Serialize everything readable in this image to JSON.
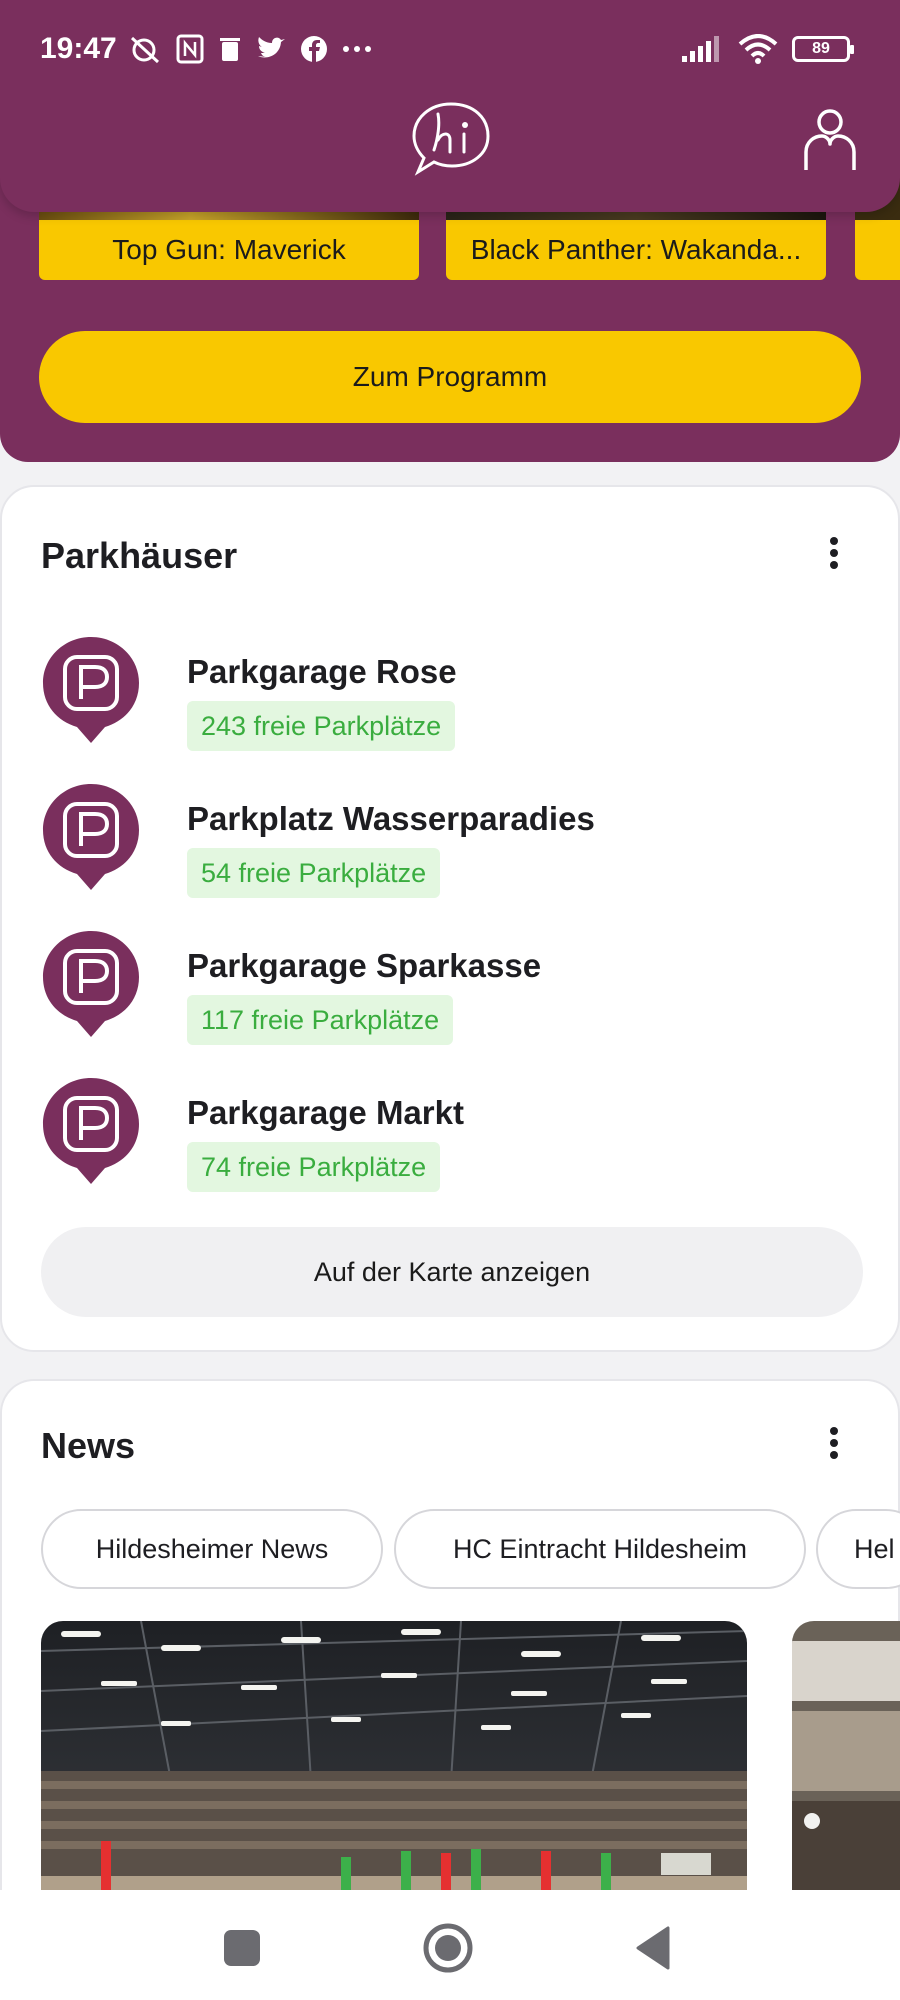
{
  "status_bar": {
    "time": "19:47",
    "battery": "89"
  },
  "movies": [
    {
      "title": "Top Gun: Maverick"
    },
    {
      "title": "Black Panther: Wakanda..."
    }
  ],
  "program_button": "Zum Programm",
  "parking": {
    "title": "Parkhäuser",
    "items": [
      {
        "name": "Parkgarage Rose",
        "free": "243 freie Parkplätze"
      },
      {
        "name": "Parkplatz Wasserparadies",
        "free": "54 freie Parkplätze"
      },
      {
        "name": "Parkgarage Sparkasse",
        "free": "117 freie Parkplätze"
      },
      {
        "name": "Parkgarage Markt",
        "free": "74 freie Parkplätze"
      }
    ],
    "map_button": "Auf der Karte anzeigen"
  },
  "news": {
    "title": "News",
    "chips": [
      "Hildesheimer News",
      "HC Eintracht Hildesheim",
      "Hel"
    ]
  },
  "colors": {
    "brand_purple": "#7a2f5d",
    "accent_yellow": "#f9c800",
    "free_green": "#3aad3f",
    "free_green_bg": "#e3f7e0"
  }
}
